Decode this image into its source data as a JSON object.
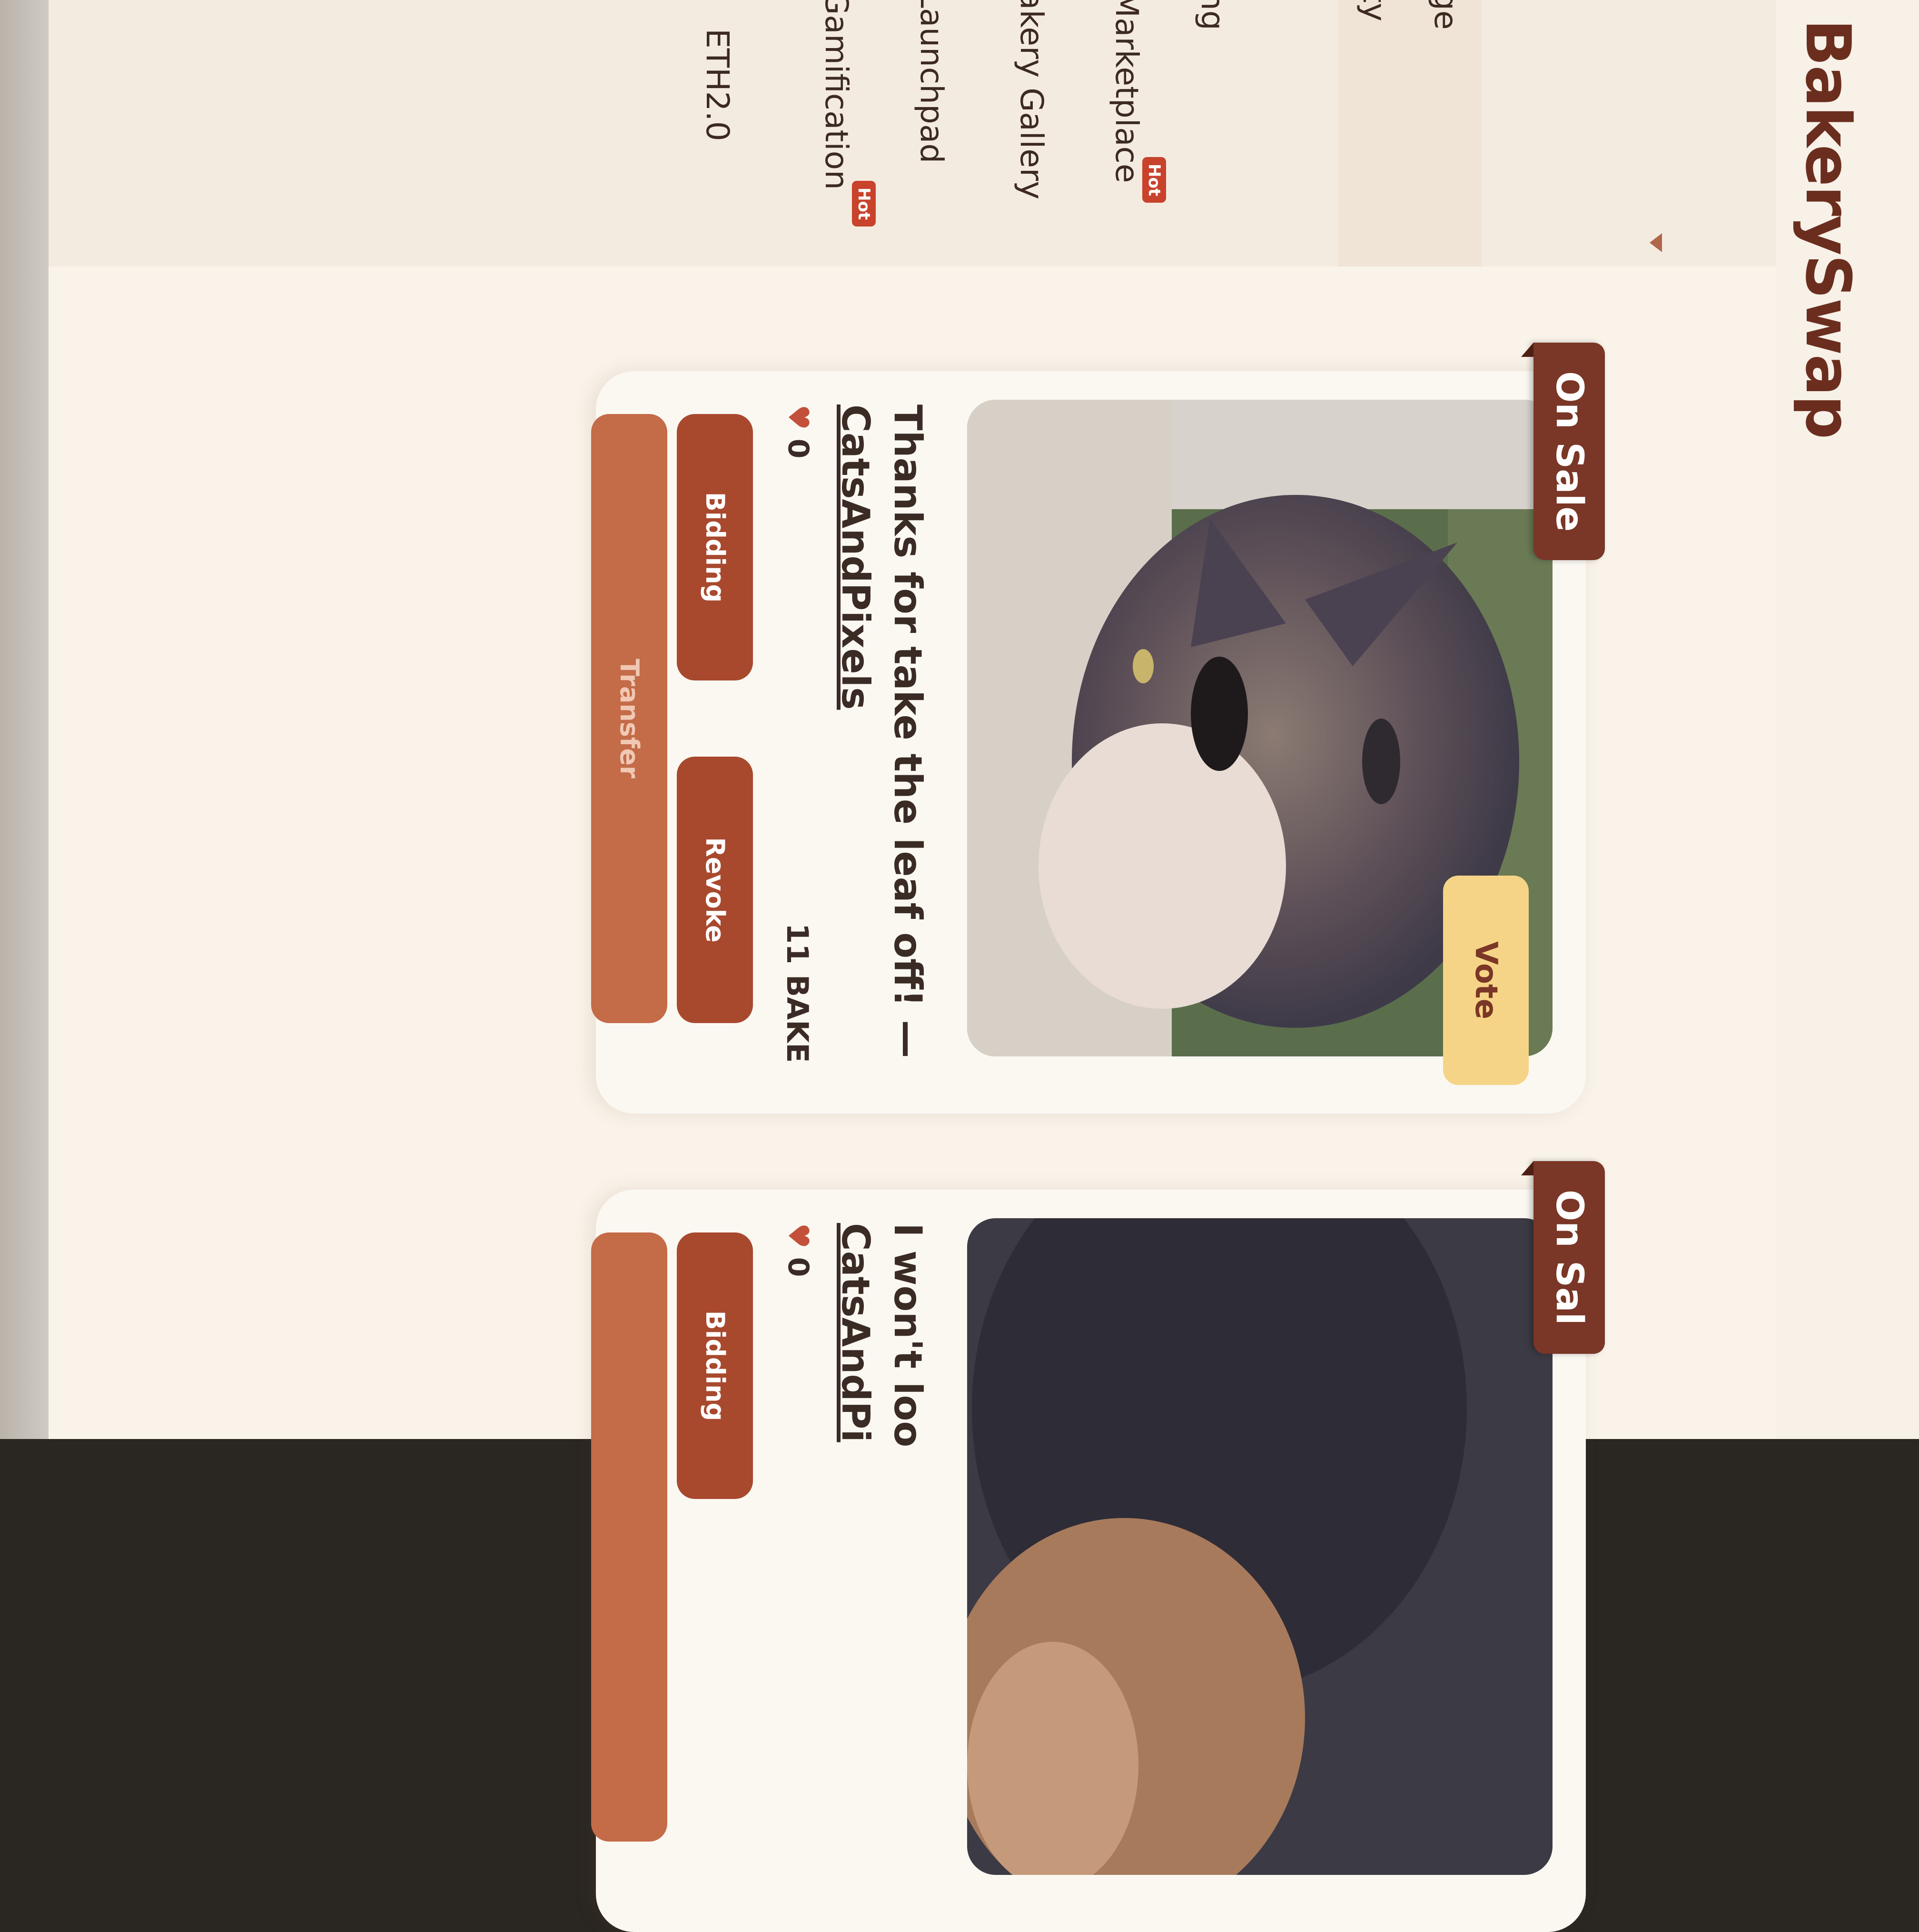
{
  "app": {
    "logo": "BakerySwap"
  },
  "sidebar": {
    "items": [
      {
        "label": "ge",
        "hot": ""
      },
      {
        "label": "ty",
        "hot": ""
      },
      {
        "label": "ng",
        "hot": ""
      },
      {
        "label": "Marketplace",
        "hot": "Hot"
      },
      {
        "label": "akery Gallery",
        "hot": ""
      },
      {
        "label": "Launchpad",
        "hot": ""
      },
      {
        "label": "Gamification",
        "hot": "Hot"
      },
      {
        "label": "ETH2.0",
        "hot": ""
      }
    ]
  },
  "cards": [
    {
      "status": "On Sale",
      "vote": "Vote",
      "title": "Thanks for take the leaf off! —",
      "author": "CatsAndPixels",
      "likes": "0",
      "price": "11 BAKE",
      "buttons": {
        "bidding": "Bidding",
        "revoke": "Revoke",
        "transfer": "Transfer"
      }
    },
    {
      "status": "On Sal",
      "title": "I won't loo",
      "author": "CatsAndPi",
      "likes": "0",
      "buttons": {
        "bidding": "Bidding"
      }
    }
  ]
}
